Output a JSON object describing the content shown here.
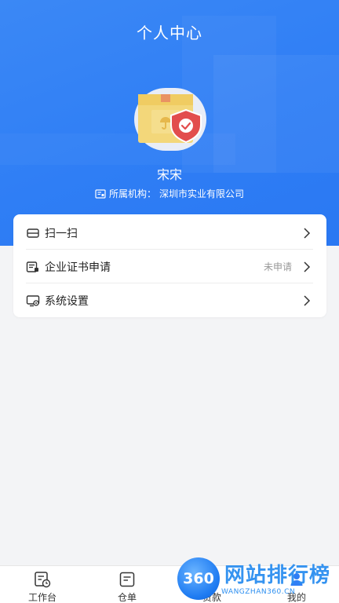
{
  "header": {
    "title": "个人中心"
  },
  "profile": {
    "name": "宋宋",
    "org_label": "所属机构：",
    "org_name": "深圳市实业有限公司"
  },
  "menu": [
    {
      "label": "扫一扫",
      "status": "",
      "icon": "scan-icon"
    },
    {
      "label": "企业证书申请",
      "status": "未申请",
      "icon": "certificate-icon"
    },
    {
      "label": "系统设置",
      "status": "",
      "icon": "settings-icon"
    }
  ],
  "tabbar": [
    {
      "label": "工作台",
      "icon": "workbench-icon"
    },
    {
      "label": "仓单",
      "icon": "warehouse-receipt-icon"
    },
    {
      "label": "贷款",
      "icon": "loan-icon"
    },
    {
      "label": "我的",
      "icon": "profile-icon"
    }
  ],
  "watermark": {
    "badge": "360",
    "title": "网站排行榜",
    "sub": "WANGZHAN360.CN"
  },
  "colors": {
    "primary": "#2f7ef5",
    "background": "#f3f4f6"
  }
}
